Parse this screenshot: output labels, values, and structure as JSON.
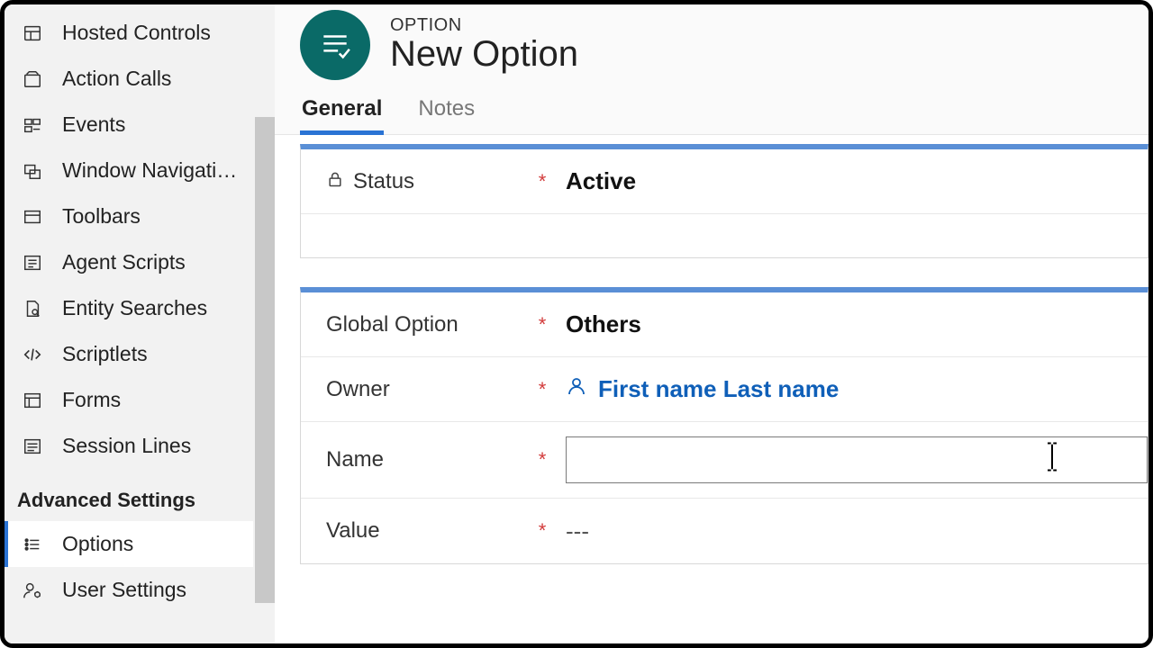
{
  "sidebar": {
    "items": [
      {
        "label": "Hosted Controls"
      },
      {
        "label": "Action Calls"
      },
      {
        "label": "Events"
      },
      {
        "label": "Window Navigatio…"
      },
      {
        "label": "Toolbars"
      },
      {
        "label": "Agent Scripts"
      },
      {
        "label": "Entity Searches"
      },
      {
        "label": "Scriptlets"
      },
      {
        "label": "Forms"
      },
      {
        "label": "Session Lines"
      }
    ],
    "section_heading": "Advanced Settings",
    "adv_items": [
      {
        "label": "Options"
      },
      {
        "label": "User Settings"
      }
    ]
  },
  "header": {
    "eyebrow": "OPTION",
    "title": "New Option"
  },
  "tabs": [
    {
      "label": "General",
      "active": true
    },
    {
      "label": "Notes",
      "active": false
    }
  ],
  "form": {
    "status": {
      "label": "Status",
      "required": true,
      "locked": true,
      "value": "Active"
    },
    "global_option": {
      "label": "Global Option",
      "required": true,
      "value": "Others"
    },
    "owner": {
      "label": "Owner",
      "required": true,
      "value": "First name Last name"
    },
    "name": {
      "label": "Name",
      "required": true,
      "value": ""
    },
    "value": {
      "label": "Value",
      "required": true,
      "value": "---"
    }
  },
  "colors": {
    "accent": "#2a73d4",
    "teal": "#0a6a67",
    "link": "#0f5fb8",
    "required": "#d23a3a"
  },
  "asterisk": "*"
}
